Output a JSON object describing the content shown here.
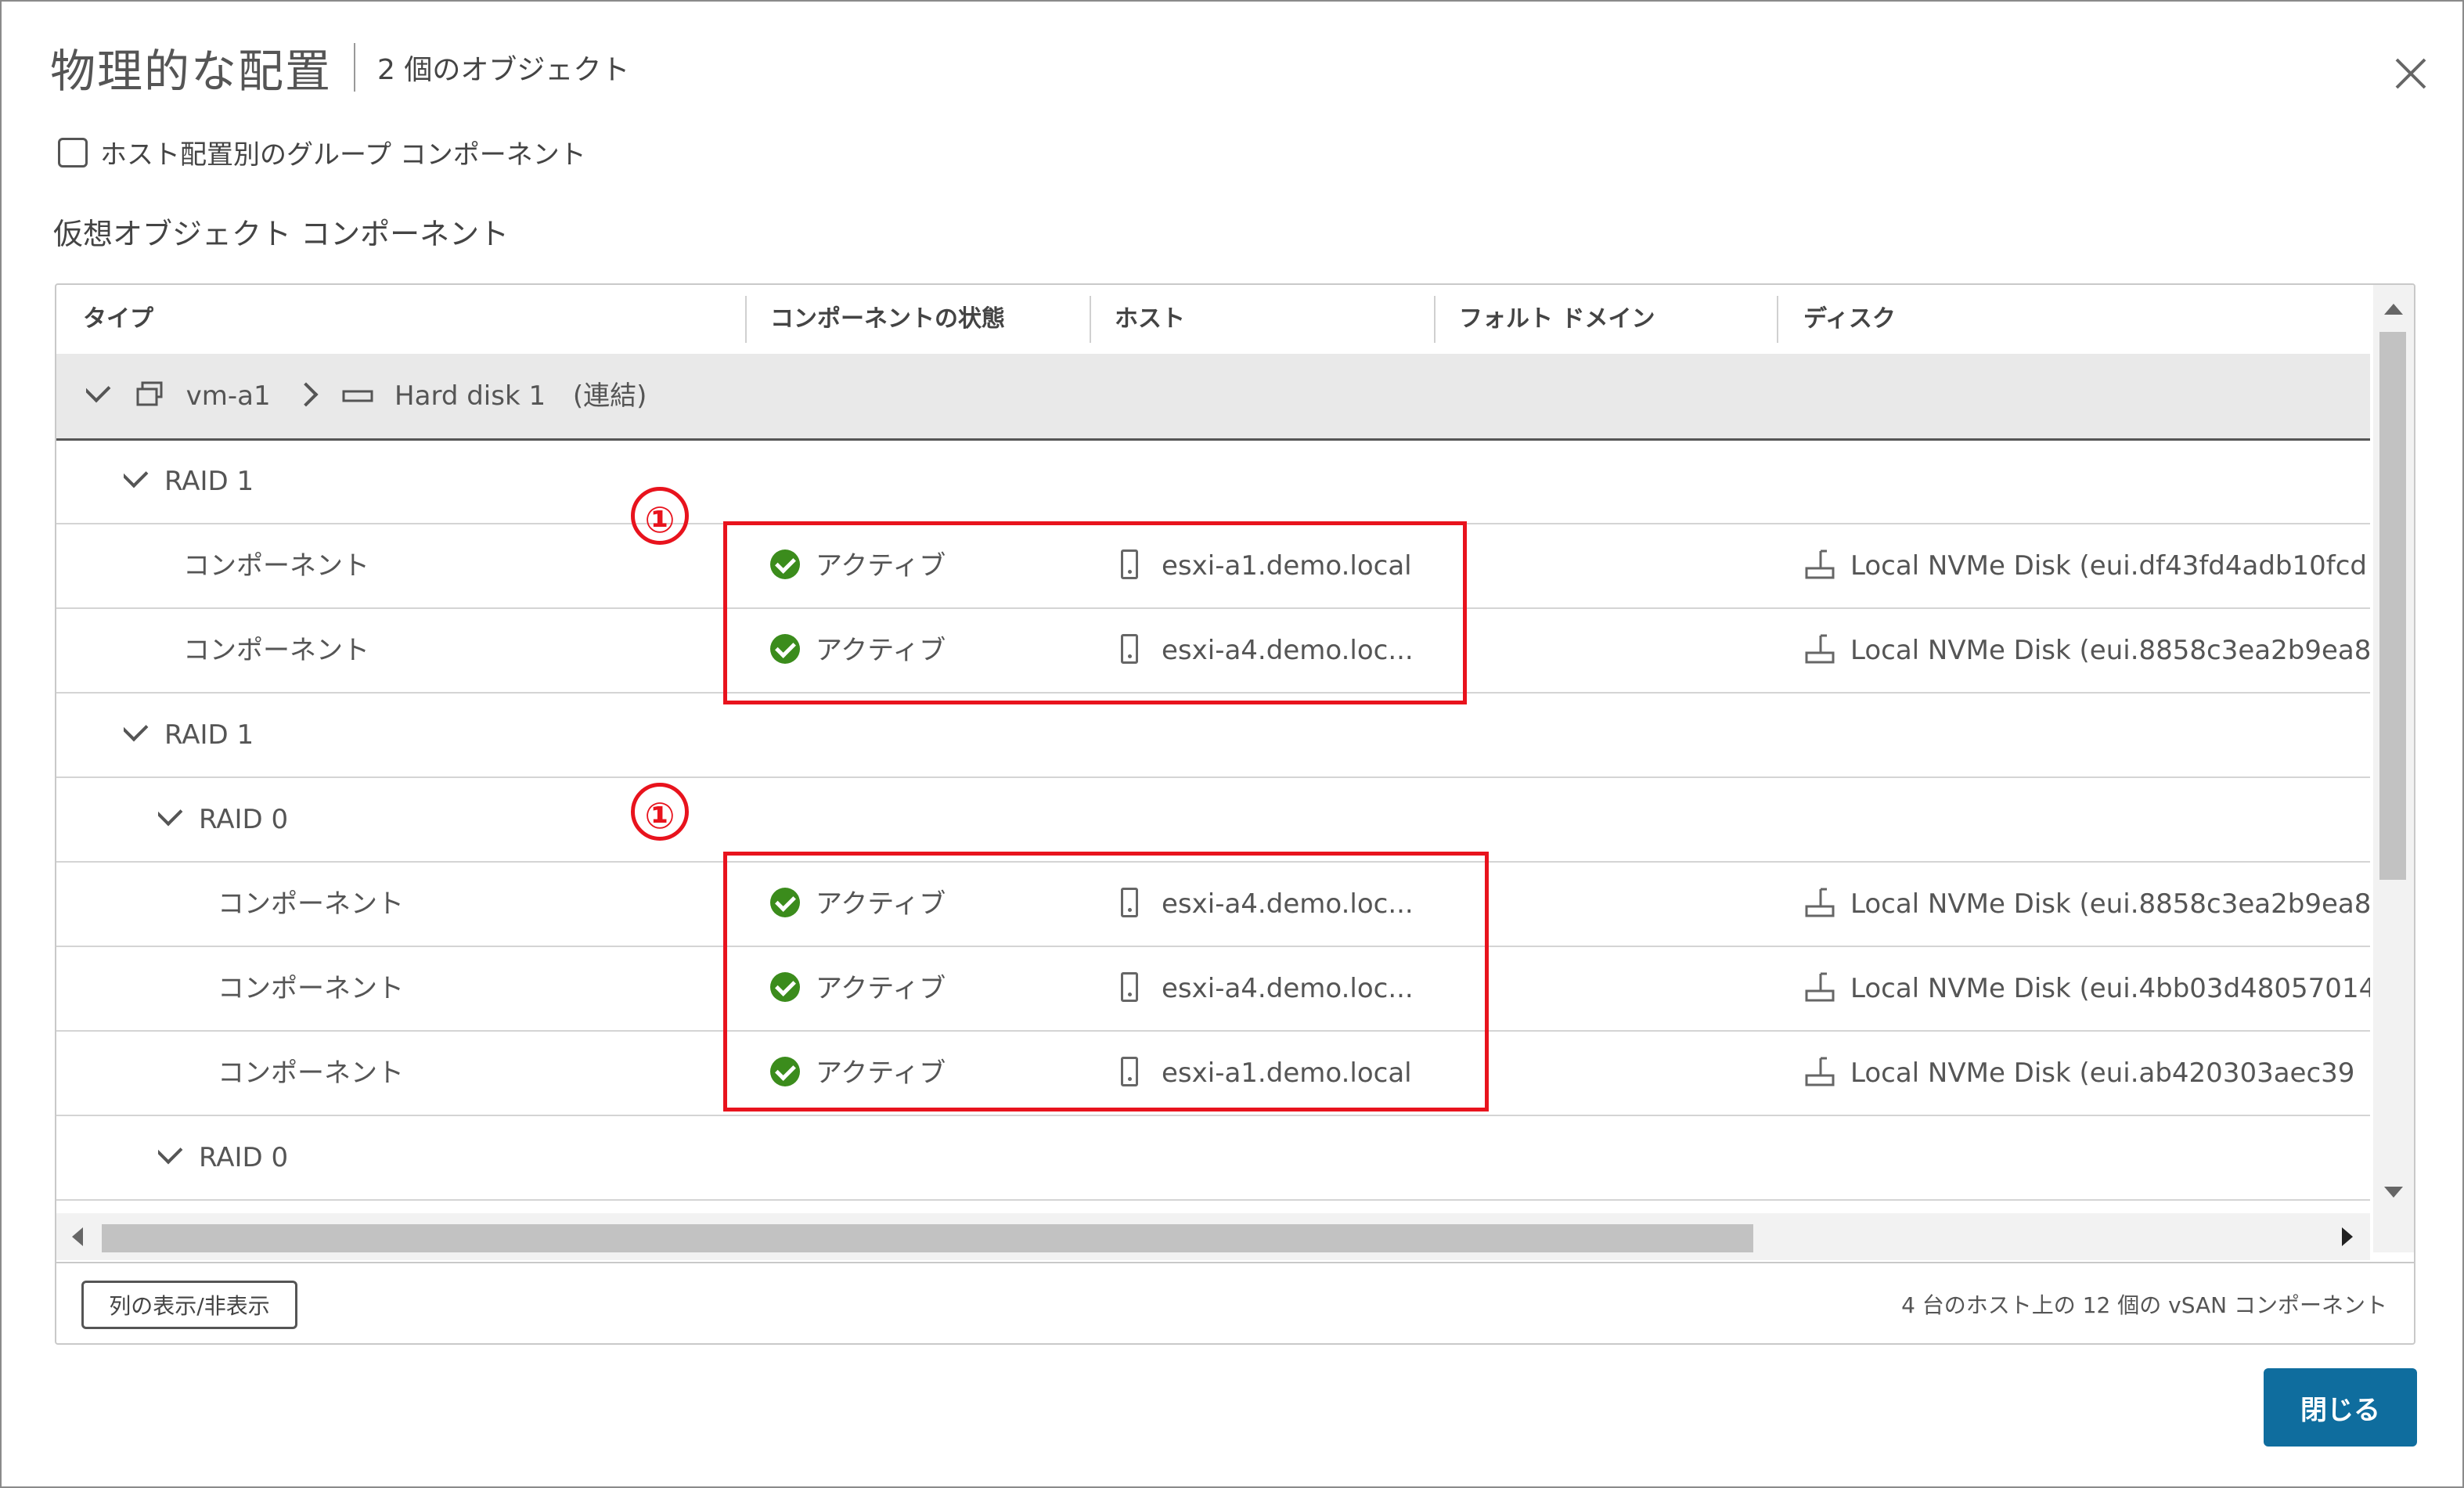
{
  "dialog": {
    "title": "物理的な配置",
    "subtitle": "2 個のオブジェクト",
    "group_checkbox_label": "ホスト配置別のグループ コンポーネント",
    "section_label": "仮想オブジェクト コンポーネント",
    "close_button_label": "閉じる"
  },
  "table": {
    "columns": [
      "タイプ",
      "コンポーネントの状態",
      "ホスト",
      "フォルト ドメイン",
      "ディスク"
    ],
    "vm_row": {
      "vm": "vm-a1",
      "disk": "Hard disk 1",
      "suffix": "(連結)"
    },
    "rows": [
      {
        "type": "RAID 1",
        "kind": "group"
      },
      {
        "type": "コンポーネント",
        "kind": "component",
        "status": "アクティブ",
        "host": "esxi-a1.demo.local",
        "fault_domain": "",
        "disk": "Local NVMe Disk (eui.df43fd4adb10fcd"
      },
      {
        "type": "コンポーネント",
        "kind": "component",
        "status": "アクティブ",
        "host": "esxi-a4.demo.loc...",
        "fault_domain": "",
        "disk": "Local NVMe Disk (eui.8858c3ea2b9ea8"
      },
      {
        "type": "RAID 1",
        "kind": "group"
      },
      {
        "type": "RAID 0",
        "kind": "group"
      },
      {
        "type": "コンポーネント",
        "kind": "component",
        "status": "アクティブ",
        "host": "esxi-a4.demo.loc...",
        "fault_domain": "",
        "disk": "Local NVMe Disk (eui.8858c3ea2b9ea8"
      },
      {
        "type": "コンポーネント",
        "kind": "component",
        "status": "アクティブ",
        "host": "esxi-a4.demo.loc...",
        "fault_domain": "",
        "disk": "Local NVMe Disk (eui.4bb03d48057014"
      },
      {
        "type": "コンポーネント",
        "kind": "component",
        "status": "アクティブ",
        "host": "esxi-a1.demo.local",
        "fault_domain": "",
        "disk": "Local NVMe Disk (eui.ab420303aec39"
      },
      {
        "type": "RAID 0",
        "kind": "group"
      }
    ]
  },
  "footer": {
    "columns_button_label": "列の表示/非表示",
    "summary": "4 台のホスト上の 12 個の vSAN コンポーネント"
  },
  "annotations": {
    "marker_1": "①",
    "marker_2": "①"
  },
  "colors": {
    "accent": "#0f6d9e",
    "status_active": "#3b8c1c",
    "annotation": "#e8131d"
  }
}
